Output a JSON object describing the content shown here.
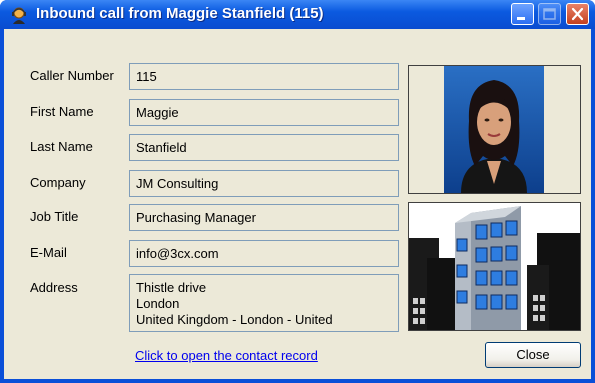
{
  "window": {
    "title": "Inbound call from Maggie Stanfield (115)"
  },
  "fields": {
    "caller_number": {
      "label": "Caller Number",
      "value": "115"
    },
    "first_name": {
      "label": "First Name",
      "value": "Maggie"
    },
    "last_name": {
      "label": "Last Name",
      "value": "Stanfield"
    },
    "company": {
      "label": "Company",
      "value": "JM Consulting"
    },
    "job_title": {
      "label": "Job Title",
      "value": "Purchasing Manager"
    },
    "email": {
      "label": "E-Mail",
      "value": "info@3cx.com"
    },
    "address": {
      "label": "Address",
      "lines": [
        "Thistle drive",
        "London",
        "United Kingdom - London - United"
      ]
    }
  },
  "actions": {
    "open_record_link": "Click to open the contact record",
    "close_label": "Close"
  },
  "icons": {
    "title": "user-headset-icon",
    "minimize": "minimize-icon",
    "maximize": "maximize-icon",
    "close": "close-icon"
  },
  "colors": {
    "titlebar": "#0a5ae0",
    "client_bg": "#ece9d8",
    "field_border": "#7f9db9",
    "link": "#0000ee",
    "close_button_bg": "#c4401f"
  }
}
